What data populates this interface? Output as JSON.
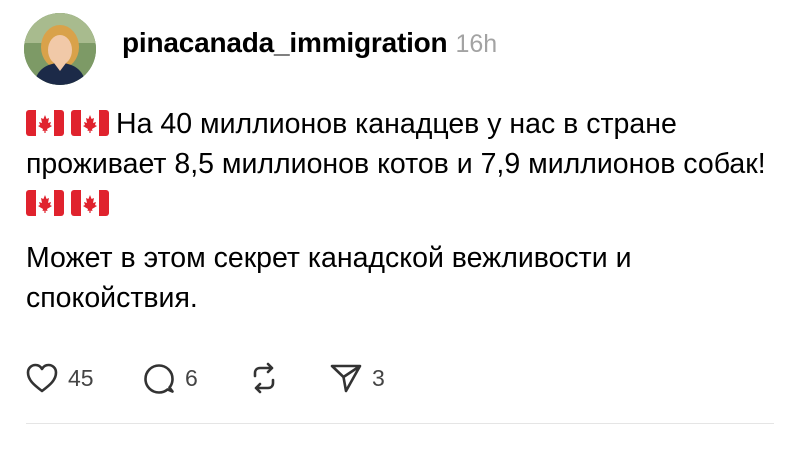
{
  "post": {
    "username": "pinacanada_immigration",
    "timestamp": "16h",
    "flag_emoji": "canada-flag",
    "paragraphs": {
      "first": "На 40 миллионов канадцев у нас в стране проживает 8,5 миллионов котов и 7,9 миллионов собак!",
      "second": "Может в этом секрет канадской вежливости и спокойствия."
    }
  },
  "actions": {
    "likes": "45",
    "replies": "6",
    "shares": "3"
  },
  "colors": {
    "text": "#000000",
    "muted": "#a3a3a3",
    "flag_red": "#e0232e",
    "divider": "#e5e5e5"
  }
}
